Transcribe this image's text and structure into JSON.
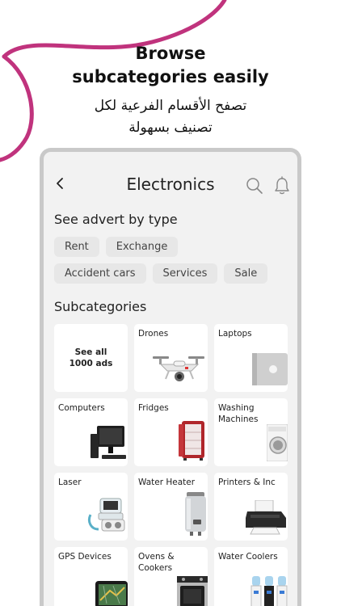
{
  "promo": {
    "headline_line1": "Browse",
    "headline_line2": "subcategories easily",
    "arabic_line1": "تصفح الأقسام الفرعية لكل",
    "arabic_line2": "تصنيف بسهولة"
  },
  "colors": {
    "swoosh": "#c0337d",
    "frame": "#c9c9c9",
    "screen_bg": "#f2f2f2",
    "chip_bg": "#e7e7e7"
  },
  "header": {
    "title": "Electronics",
    "back_icon": "chevron-left-icon",
    "search_icon": "search-icon",
    "bell_icon": "bell-icon"
  },
  "advert_types": {
    "title": "See advert by type",
    "chips": [
      "Rent",
      "Exchange",
      "Accident cars",
      "Services",
      "Sale"
    ]
  },
  "subcategories": {
    "title": "Subcategories",
    "see_all_line1": "See all",
    "see_all_line2": "1000 ads",
    "items": [
      {
        "label": "Drones",
        "icon": "drone-icon"
      },
      {
        "label": "Laptops",
        "icon": "laptop-icon"
      },
      {
        "label": "Computers",
        "icon": "computer-icon"
      },
      {
        "label": "Fridges",
        "icon": "fridge-icon"
      },
      {
        "label": "Washing Machines",
        "icon": "washing-machine-icon"
      },
      {
        "label": "Laser",
        "icon": "laser-device-icon"
      },
      {
        "label": "Water Heater",
        "icon": "water-heater-icon"
      },
      {
        "label": "Printers & Inc",
        "icon": "printer-icon"
      },
      {
        "label": "GPS Devices",
        "icon": "gps-device-icon"
      },
      {
        "label": "Ovens & Cookers",
        "icon": "oven-icon"
      },
      {
        "label": "Water Coolers",
        "icon": "water-cooler-icon"
      }
    ]
  }
}
